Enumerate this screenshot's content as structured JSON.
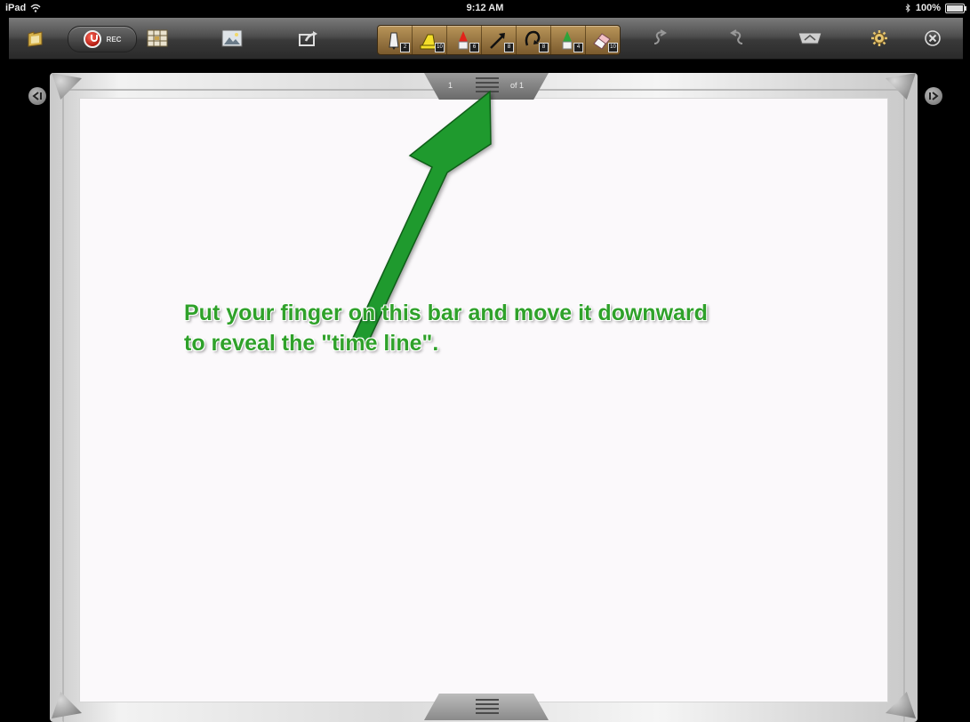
{
  "status_bar": {
    "device": "iPad",
    "time": "9:12 AM",
    "battery": "100%"
  },
  "toolbar": {
    "rec_label": "REC",
    "tool_badges": [
      "2",
      "10",
      "6",
      "8",
      "8",
      "4",
      "10"
    ]
  },
  "page_indicator": {
    "current": "1",
    "total": "of 1"
  },
  "annotation": {
    "line1": "Put your finger on this bar and move it downward",
    "line2": "to reveal the \"time line\"."
  },
  "colors": {
    "annotation_green": "#2fa12a",
    "arrow_green": "#1f9a2e"
  }
}
